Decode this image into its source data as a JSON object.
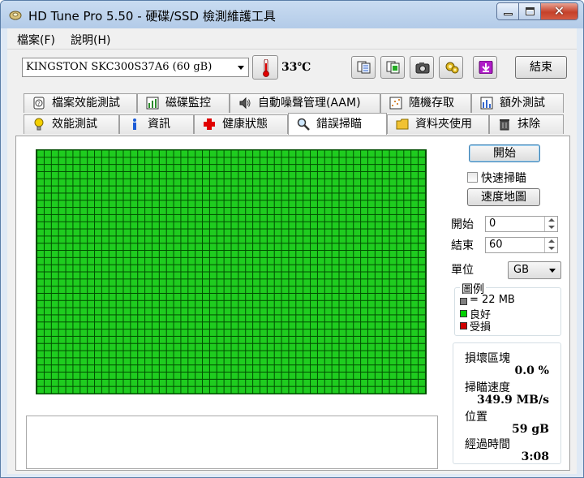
{
  "window": {
    "title": "HD Tune Pro 5.50 - 硬碟/SSD 檢測維護工具"
  },
  "menu": {
    "file": "檔案(F)",
    "help": "說明(H)"
  },
  "toolbar": {
    "drive": "KINGSTON SKC300S37A6 (60 gB)",
    "temperature": "33℃",
    "exit": "結束"
  },
  "tabs_top": [
    {
      "label": "檔案效能測試"
    },
    {
      "label": "磁碟監控"
    },
    {
      "label": "自動噪聲管理(AAM)"
    },
    {
      "label": "隨機存取"
    },
    {
      "label": "額外測試"
    }
  ],
  "tabs_bottom": [
    {
      "label": "效能測試"
    },
    {
      "label": "資訊"
    },
    {
      "label": "健康狀態"
    },
    {
      "label": "錯誤掃瞄"
    },
    {
      "label": "資料夾使用"
    },
    {
      "label": "抹除"
    }
  ],
  "scan": {
    "start_button": "開始",
    "quick_scan": "快速掃瞄",
    "quick_scan_checked": false,
    "speed_map_button": "速度地圖",
    "start_label": "開始",
    "start_value": "0",
    "end_label": "結束",
    "end_value": "60",
    "unit_label": "單位",
    "unit_value": "GB",
    "legend": {
      "title": "圖例",
      "block": "= 22 MB",
      "good": "良好",
      "damaged": "受損",
      "block_color": "#808080",
      "good_color": "#00d000",
      "damaged_color": "#d00000"
    },
    "stats": {
      "damaged_blocks_label": "損壞區塊",
      "damaged_blocks_value": "0.0 %",
      "scan_speed_label": "掃瞄速度",
      "scan_speed_value": "349.9 MB/s",
      "position_label": "位置",
      "position_value": "59 gB",
      "elapsed_label": "經過時間",
      "elapsed_value": "3:08"
    },
    "grid_color": "#1fcc1f"
  }
}
